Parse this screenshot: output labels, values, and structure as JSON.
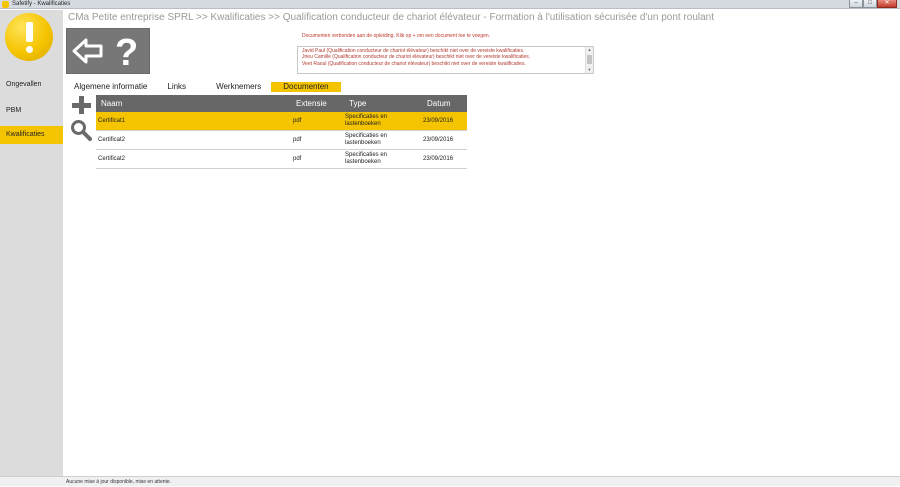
{
  "window": {
    "title": "Safetify - Kwalificaties",
    "minimize": "–",
    "maximize": "□",
    "close": "✕"
  },
  "sidebar": {
    "items": [
      {
        "label": "Ongevallen",
        "active": false
      },
      {
        "label": "PBM",
        "active": false
      },
      {
        "label": "Kwalificaties",
        "active": true
      }
    ]
  },
  "breadcrumb": "CMa Petite entreprise SPRL >> Kwalificaties >> Qualification conducteur de chariot élévateur - Formation à l'utilisation sécurisée d'un pont roulant",
  "info": {
    "label": "Documenten verbonden aan de opleiding. Klik op + om een document toe te voegen.",
    "messages": [
      "Javid Paul (Qualification conducteur de chariot élévateur) beschikt niet over de vereiste kwalificaties.",
      "Jrieu Camille (Qualification conducteur de chariot élévateur) beschikt niet over de vereiste kwalificaties.",
      "Veet Raoul (Qualification conducteur de chariot élévateur) beschikt niet over de vereiste kwalificaties."
    ]
  },
  "tabs": [
    {
      "label": "Algemene informatie",
      "active": false
    },
    {
      "label": "Links",
      "active": false
    },
    {
      "label": "Werknemers",
      "active": false
    },
    {
      "label": "Documenten",
      "active": true
    }
  ],
  "table": {
    "columns": [
      "Naam",
      "Extensie",
      "Type",
      "Datum"
    ],
    "rows": [
      {
        "name": "Certificat1",
        "ext": "pdf",
        "type": "Specificaties en lastenboeken",
        "date": "23/09/2016",
        "selected": true
      },
      {
        "name": "Certificat2",
        "ext": "pdf",
        "type": "Specificaties en lastenboeken",
        "date": "23/09/2016",
        "selected": false
      },
      {
        "name": "Certificat2",
        "ext": "pdf",
        "type": "Specificaties en lastenboeken",
        "date": "23/09/2016",
        "selected": false
      }
    ]
  },
  "status": "Aucune mise à jour disponible, mise en attente.",
  "colors": {
    "accent": "#f5c400",
    "header": "#676767",
    "sidebar": "#dcdcdc",
    "message": "#b03a2e"
  },
  "icons": [
    "warning-logo-icon",
    "back-arrow-icon",
    "help-icon",
    "add-icon",
    "search-icon"
  ]
}
